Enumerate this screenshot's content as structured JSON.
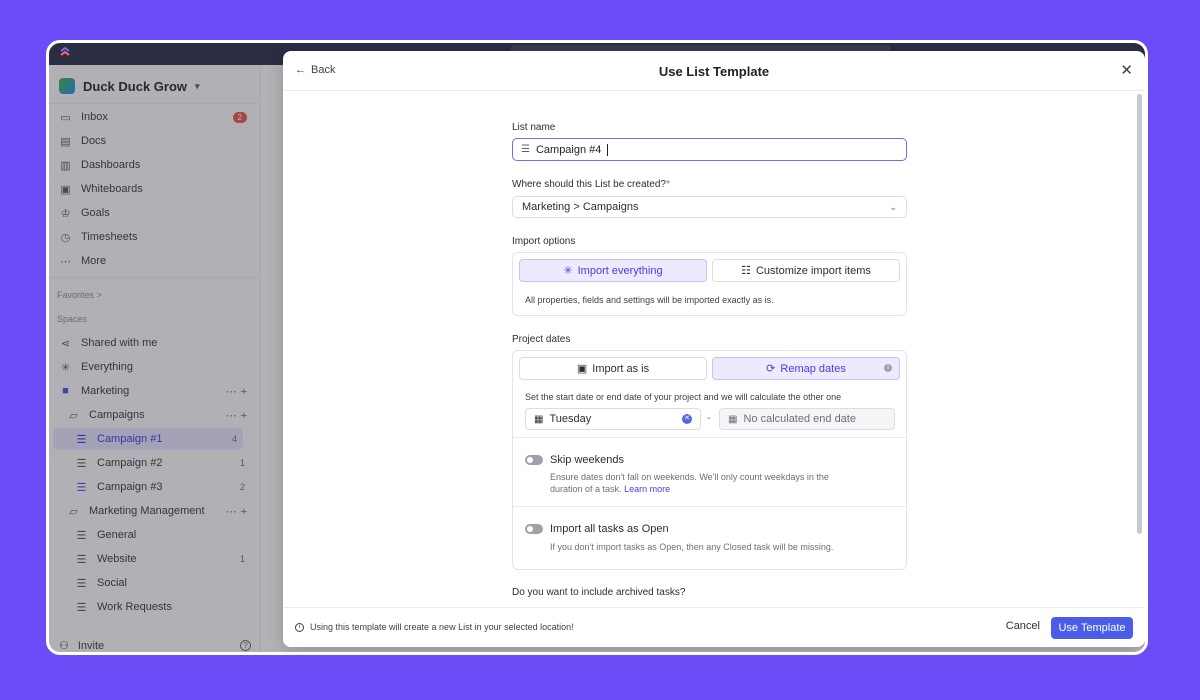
{
  "sidebar": {
    "workspace_name": "Duck Duck Grow",
    "nav": [
      {
        "label": "Inbox",
        "icon": "inbox-icon",
        "badge": "2"
      },
      {
        "label": "Docs",
        "icon": "doc-icon"
      },
      {
        "label": "Dashboards",
        "icon": "dashboard-icon"
      },
      {
        "label": "Whiteboards",
        "icon": "whiteboard-icon"
      },
      {
        "label": "Goals",
        "icon": "trophy-icon"
      },
      {
        "label": "Timesheets",
        "icon": "timer-icon"
      },
      {
        "label": "More",
        "icon": "more-icon"
      }
    ],
    "favorites_label": "Favorites >",
    "spaces_label": "Spaces",
    "spaces": [
      {
        "label": "Shared with me"
      },
      {
        "label": "Everything"
      },
      {
        "label": "Marketing"
      },
      {
        "label": "Campaigns"
      },
      {
        "label": "Campaign #1",
        "count": "4"
      },
      {
        "label": "Campaign #2",
        "count": "1"
      },
      {
        "label": "Campaign #3",
        "count": "2"
      },
      {
        "label": "Marketing Management"
      },
      {
        "label": "General"
      },
      {
        "label": "Website",
        "count": "1"
      },
      {
        "label": "Social"
      },
      {
        "label": "Work Requests"
      }
    ],
    "invite_label": "Invite"
  },
  "modal": {
    "back_label": "Back",
    "title": "Use List Template",
    "list_name_label": "List name",
    "list_name_value": "Campaign #4",
    "location_label": "Where should this List be created?",
    "location_required": "*",
    "location_value": "Marketing > Campaigns",
    "import_options_label": "Import options",
    "import_everything_label": "Import everything",
    "customize_label": "Customize import items",
    "import_note": "All properties, fields and settings will be imported exactly as is.",
    "project_dates_label": "Project dates",
    "import_as_is_label": "Import as is",
    "remap_dates_label": "Remap dates",
    "remap_note": "Set the start date or end date of your project and we will calculate the other one",
    "start_date_value": "Tuesday",
    "end_date_placeholder": "No calculated end date",
    "skip_weekends_title": "Skip weekends",
    "skip_weekends_desc": "Ensure dates don't fall on weekends. We'll only count weekdays in the duration of a task.",
    "learn_more": "Learn more",
    "import_open_title": "Import all tasks as Open",
    "import_open_desc": "If you don't import tasks as Open, then any Closed task will be missing.",
    "archived_label": "Do you want to include archived tasks?",
    "footer_note": "Using this template will create a new List in your selected location!",
    "cancel_label": "Cancel",
    "use_template_label": "Use Template"
  },
  "colors": {
    "accent": "#7b68ee",
    "primary_button": "#4a5ce8",
    "background": "#6b4cf6"
  }
}
